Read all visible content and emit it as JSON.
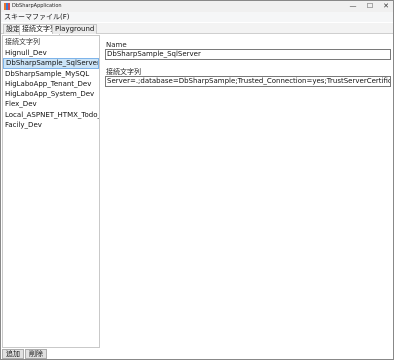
{
  "window": {
    "title": "DbSharpApplication",
    "minimize": "—",
    "maximize": "☐",
    "close": "✕"
  },
  "menu": {
    "schema_file": "スキーマファイル(F)"
  },
  "tabs": [
    {
      "label": "設定"
    },
    {
      "label": "接続文字列"
    },
    {
      "label": "Playground"
    }
  ],
  "connections": {
    "header": "接続文字列",
    "items": [
      "Hignull_Dev",
      "DbSharpSample_SqlServer",
      "DbSharpSample_MySQL",
      "HigLaboApp_Tenant_Dev",
      "HigLaboApp_System_Dev",
      "Flex_Dev",
      "Local_ASPNET_HTMX_Todo_Sar",
      "Facily_Dev"
    ],
    "selected_index": 1
  },
  "buttons": {
    "add": "追加",
    "delete": "削除"
  },
  "detail": {
    "name_label": "Name",
    "name_value": "DbSharpSample_SqlServer",
    "conn_label": "接続文字列",
    "conn_value": "Server=.;database=DbSharpSample;Trusted_Connection=yes;TrustServerCertificate=True;"
  }
}
